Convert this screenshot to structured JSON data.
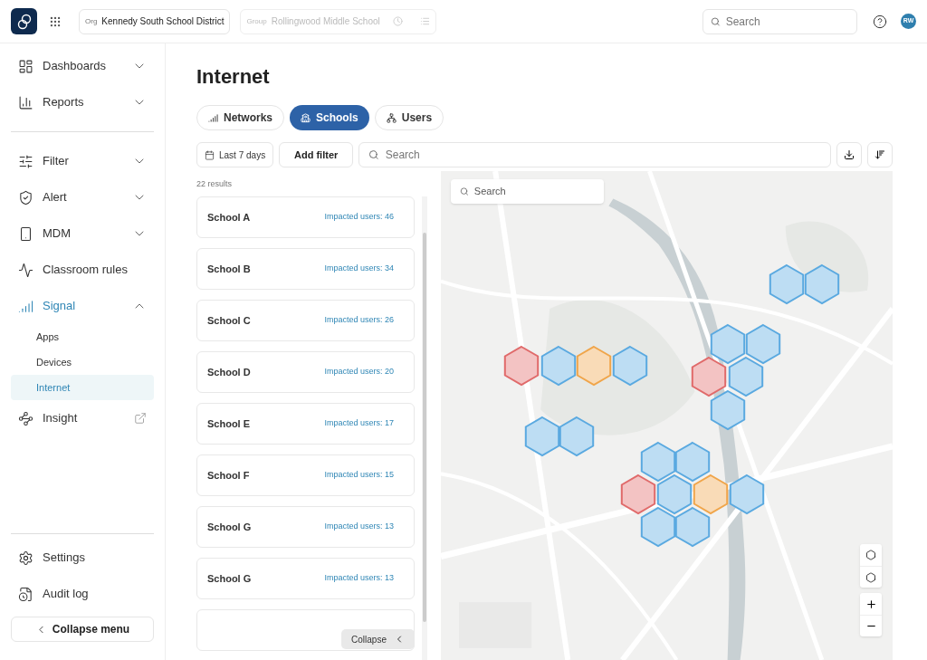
{
  "topbar": {
    "org_label": "Org",
    "org_value": "Kennedy South School District",
    "group_label": "Group",
    "group_value": "Rollingwood Middle School",
    "search_placeholder": "Search",
    "avatar": "RW"
  },
  "sidebar": {
    "sections": [
      [
        {
          "kind": "dashboards",
          "label": "Dashboards",
          "expanded": false
        },
        {
          "kind": "reports",
          "label": "Reports",
          "expanded": false
        }
      ],
      [
        {
          "kind": "filter",
          "label": "Filter",
          "expanded": false
        },
        {
          "kind": "alert",
          "label": "Alert",
          "expanded": false
        },
        {
          "kind": "mdm",
          "label": "MDM",
          "expanded": false
        },
        {
          "kind": "classroom",
          "label": "Classroom rules"
        },
        {
          "kind": "signal",
          "label": "Signal",
          "expanded": true,
          "selected": true,
          "children": [
            {
              "label": "Apps",
              "selected": false
            },
            {
              "label": "Devices",
              "selected": false
            },
            {
              "label": "Internet",
              "selected": true
            }
          ]
        },
        {
          "kind": "insight",
          "label": "Insight",
          "external": true
        }
      ]
    ],
    "footer": [
      {
        "kind": "settings",
        "label": "Settings"
      },
      {
        "kind": "audit",
        "label": "Audit log"
      }
    ],
    "collapse": "Collapse menu"
  },
  "page": {
    "title": "Internet",
    "tabs": [
      {
        "kind": "networks",
        "label": "Networks",
        "selected": false
      },
      {
        "kind": "schools",
        "label": "Schools",
        "selected": true
      },
      {
        "kind": "users",
        "label": "Users",
        "selected": false
      }
    ],
    "date_filter": "Last 7 days",
    "add_filter": "Add filter",
    "search_placeholder": "Search",
    "results": "22 results",
    "schools": [
      {
        "name": "School A",
        "impact": "Impacted users: 46"
      },
      {
        "name": "School B",
        "impact": "Impacted users: 34"
      },
      {
        "name": "School C",
        "impact": "Impacted users: 26"
      },
      {
        "name": "School D",
        "impact": "Impacted users: 20"
      },
      {
        "name": "School E",
        "impact": "Impacted users: 17"
      },
      {
        "name": "School F",
        "impact": "Impacted users: 15"
      },
      {
        "name": "School G",
        "impact": "Impacted users: 13"
      },
      {
        "name": "School G",
        "impact": "Impacted users: 13"
      }
    ],
    "collapse": "Collapse"
  },
  "map": {
    "search_placeholder": "Search",
    "hexagons": [
      {
        "color": "#5aa9e0"
      },
      {
        "color": "#5aa9e0"
      },
      {
        "color": "#5aa9e0"
      },
      {
        "color": "#5aa9e0"
      },
      {
        "color": "#e06a6a"
      },
      {
        "color": "#5aa9e0"
      },
      {
        "color": "#f0a54a"
      },
      {
        "color": "#5aa9e0"
      },
      {
        "color": "#e06a6a"
      },
      {
        "color": "#5aa9e0"
      },
      {
        "color": "#5aa9e0"
      },
      {
        "color": "#5aa9e0"
      },
      {
        "color": "#5aa9e0"
      },
      {
        "color": "#5aa9e0"
      },
      {
        "color": "#5aa9e0"
      },
      {
        "color": "#e06a6a"
      },
      {
        "color": "#5aa9e0"
      },
      {
        "color": "#f0a54a"
      },
      {
        "color": "#5aa9e0"
      },
      {
        "color": "#5aa9e0"
      },
      {
        "color": "#5aa9e0"
      }
    ]
  }
}
